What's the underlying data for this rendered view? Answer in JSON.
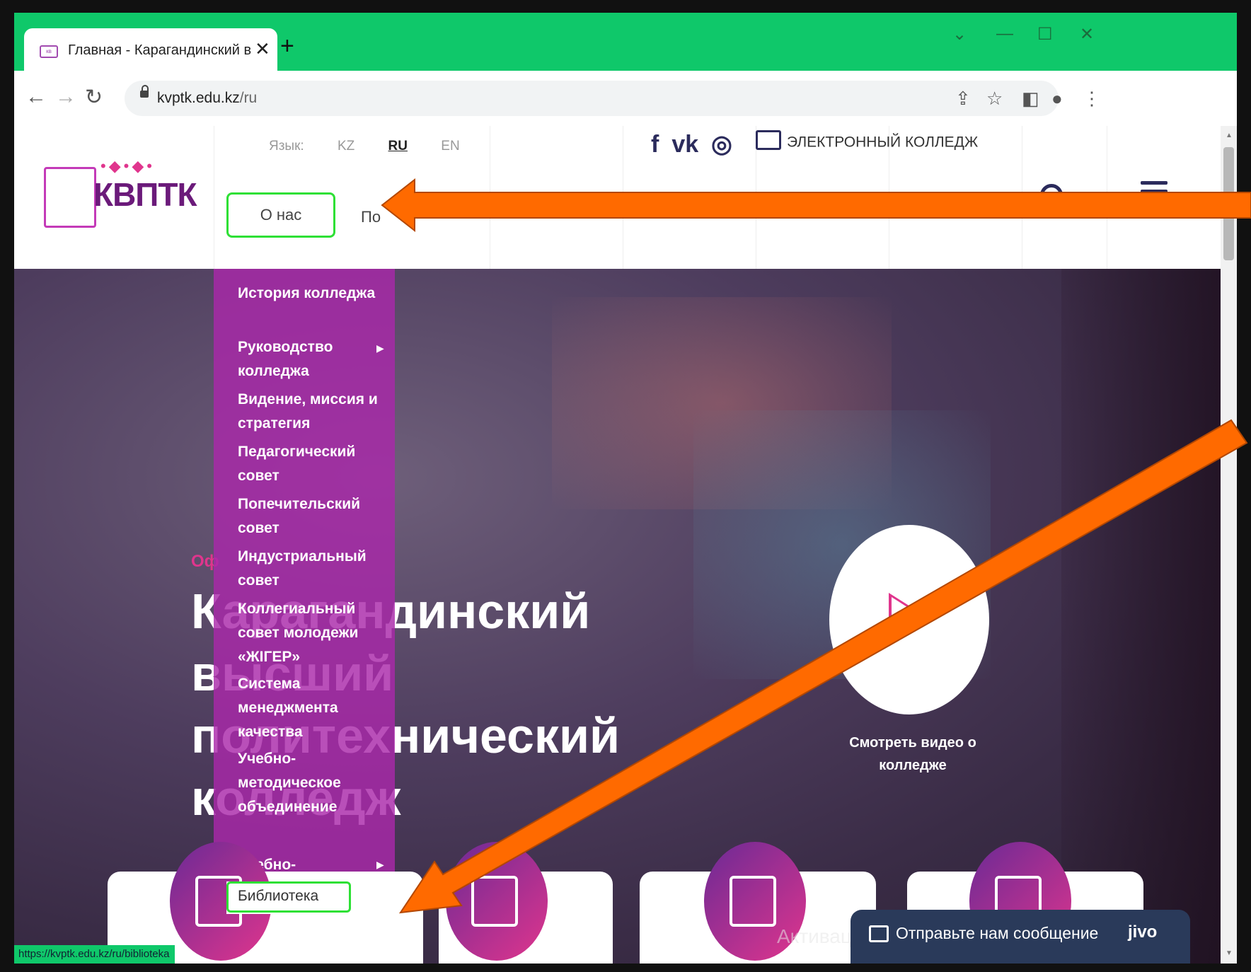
{
  "browser": {
    "tab_title": "Главная - Карагандинский высш",
    "tab_close": "✕",
    "new_tab": "+",
    "url_domain": "kvptk.edu.kz",
    "url_path": "/ru",
    "status_url": "https://kvptk.edu.kz/ru/biblioteka"
  },
  "site": {
    "logo_text": "КВПТК",
    "lang_label": "Язык:",
    "langs": [
      "KZ",
      "RU",
      "EN"
    ],
    "ecollege": "ЭЛЕКТРОННЫЙ КОЛЛЕДЖ",
    "nav_about": "О нас",
    "nav_next": "По",
    "hero_kicker": "Оф",
    "hero_title": "Карагандинский высший политехнический колледж",
    "watch_video": "Смотреть видео о колледже",
    "dropdown": [
      "История колледжа",
      "Руководство колледжа",
      "Видение, миссия и стратегия",
      "Педагогический совет",
      "Попечительский совет",
      "Индустриальный совет",
      "Коллегиальный совет молодежи «ЖІГЕР»",
      "Система менеджмента качества",
      "Учебно-методическое объединение",
      "Библиотека",
      "Учебно-материальная"
    ],
    "chat_text": "Отправьте нам сообщение",
    "chat_brand": "jivo",
    "watermark": "Активация Windows"
  },
  "colors": {
    "chrome_green": "#0fc86a",
    "brand_magenta": "#e0358d",
    "brand_purple": "#6b1a7a",
    "highlight_green": "#2ee035",
    "annotation_orange": "#ff6a00"
  }
}
